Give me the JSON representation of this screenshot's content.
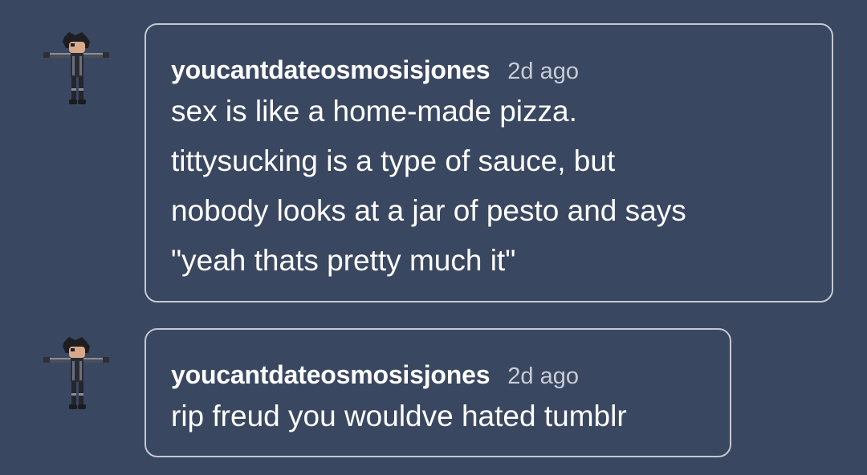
{
  "replies": [
    {
      "username": "youcantdateosmosisjones",
      "timestamp": "2d ago",
      "lines": [
        "sex is like a home-made pizza.",
        "tittysucking is a type of sauce, but",
        "nobody looks at a jar of pesto and says",
        "\"yeah thats pretty much it\""
      ]
    },
    {
      "username": "youcantdateosmosisjones",
      "timestamp": "2d ago",
      "lines": [
        "rip freud you wouldve hated tumblr"
      ]
    }
  ],
  "colors": {
    "background": "#3a4760",
    "bubble_border": "#c3c8d2",
    "text": "#ffffff",
    "muted_text": "#c7ccd6"
  },
  "icons": {
    "avatar": "t-pose-character-avatar-icon"
  }
}
